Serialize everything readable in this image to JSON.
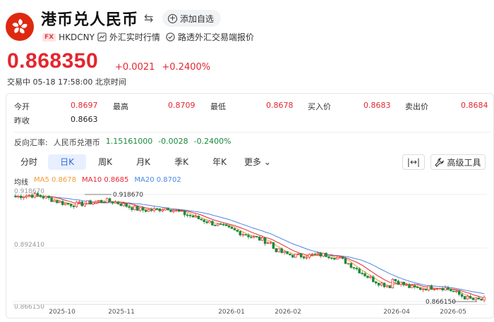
{
  "header": {
    "title": "港币兑人民币",
    "swap_icon": "swap-arrows-icon",
    "add_label": "添加自选",
    "code_tag": "FX",
    "code": "HKDCNY",
    "link1": "外汇实时行情",
    "link2": "路透外汇交易端报价"
  },
  "quote": {
    "price": "0.868350",
    "change": "+0.0021",
    "change_pct": "+0.2400%",
    "status": "交易中 05-18 17:58:00 北京时间"
  },
  "stats": {
    "open_label": "今开",
    "open": "0.8697",
    "high_label": "最高",
    "high": "0.8709",
    "low_label": "最低",
    "low": "0.8678",
    "bid_label": "买入价",
    "bid": "0.8683",
    "ask_label": "卖出价",
    "ask": "0.8684",
    "prev_label": "昨收",
    "prev": "0.8663"
  },
  "reverse": {
    "label": "反向汇率:",
    "pair": "人民币兑港币",
    "rate": "1.15161000",
    "change": "-0.0028",
    "change_pct": "-0.2400%"
  },
  "tabs": [
    "分时",
    "日K",
    "周K",
    "月K",
    "季K",
    "年K",
    "更多"
  ],
  "active_tab": "日K",
  "tools": {
    "tool_label": "高级工具"
  },
  "colors": {
    "up": "#e4262f",
    "down": "#1a8a3c",
    "ma5": "#f29d38",
    "ma10": "#e4262f",
    "ma20": "#4b86e8"
  },
  "chart_data": {
    "type": "candlestick",
    "legend": {
      "label": "均线",
      "ma5": "MA5 0.8678",
      "ma10": "MA10 0.8685",
      "ma20": "MA20 0.8702"
    },
    "y_ticks": [
      "0.918670",
      "0.892410",
      "0.866150"
    ],
    "ylim": [
      0.86615,
      0.91867
    ],
    "x_ticks": [
      "2025-10",
      "2025-11",
      "2026-01",
      "2026-02",
      "2026-04",
      "2026-05"
    ],
    "annotations": {
      "max_label": "0.918670",
      "min_label": "0.866150"
    }
  }
}
